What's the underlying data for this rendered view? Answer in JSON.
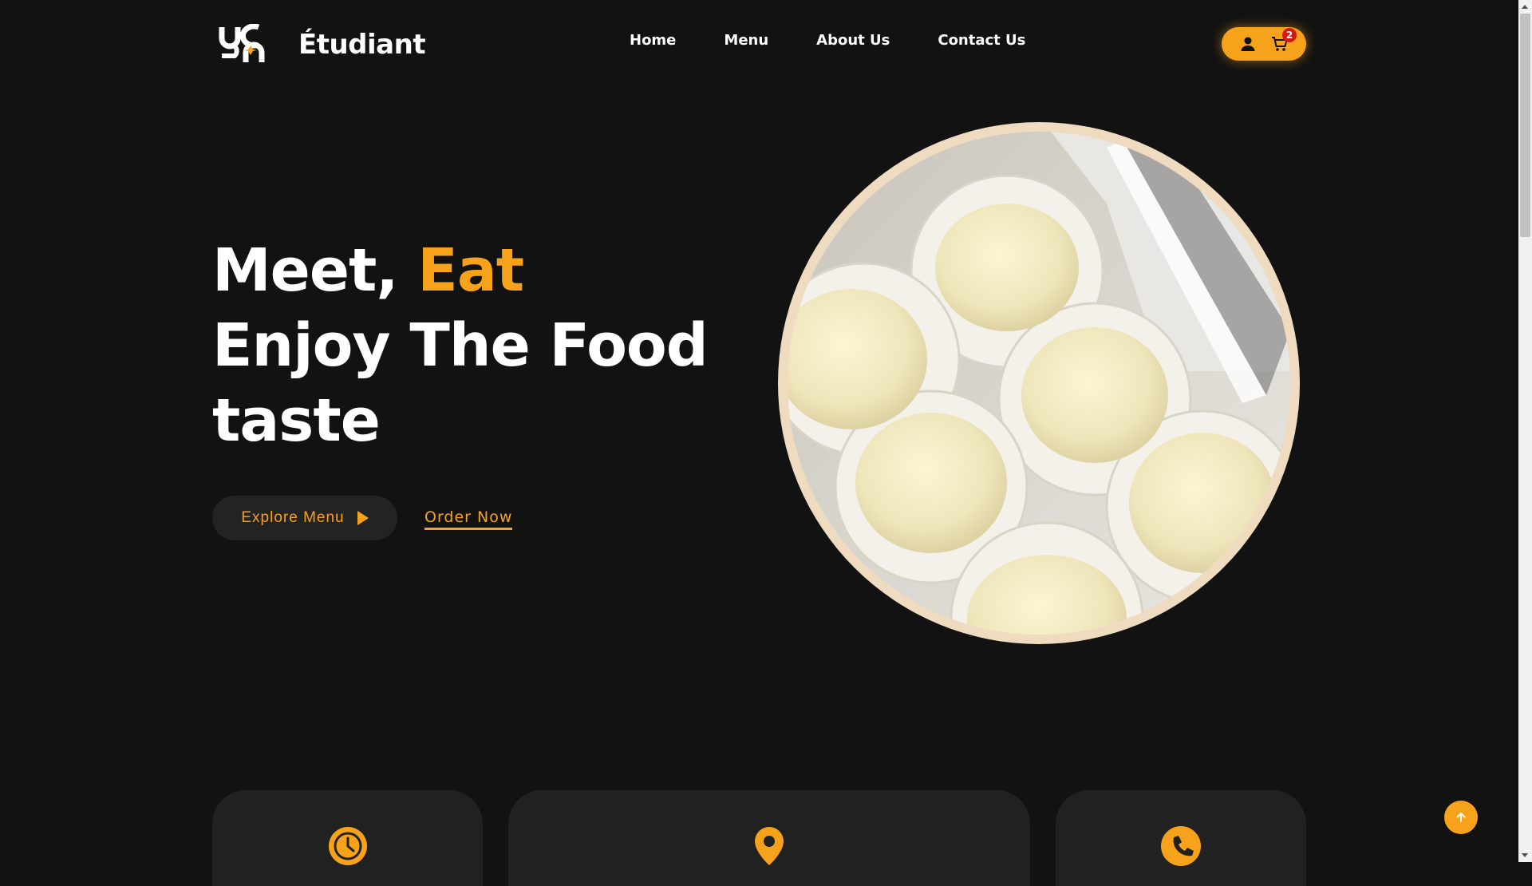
{
  "brand": {
    "name": "Étudiant",
    "logo_icon": "uca-logo"
  },
  "nav": [
    {
      "label": "Home"
    },
    {
      "label": "Menu"
    },
    {
      "label": "About Us"
    },
    {
      "label": "Contact Us"
    }
  ],
  "header_actions": {
    "user_icon": "user-icon",
    "cart_icon": "cart-icon",
    "cart_count": "2"
  },
  "hero": {
    "line1_white": "Meet, ",
    "line1_accent": "Eat",
    "line2": "Enjoy The Food",
    "line3": "taste",
    "explore_label": "Explore Menu",
    "order_label": "Order Now",
    "image": "mochi-dessert-photo"
  },
  "info_cards": [
    {
      "icon": "clock-icon"
    },
    {
      "icon": "location-pin-icon"
    },
    {
      "icon": "phone-icon"
    }
  ],
  "colors": {
    "background": "#121212",
    "accent": "#f7a21b",
    "card": "#212121",
    "badge": "#d3190f"
  }
}
